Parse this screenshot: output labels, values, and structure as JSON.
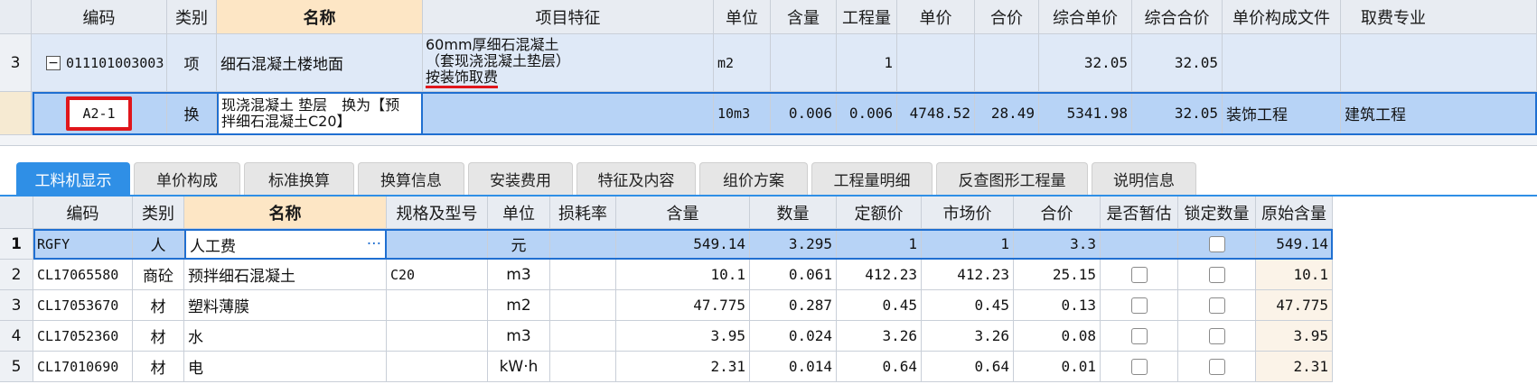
{
  "upper": {
    "headers": {
      "code": "编码",
      "category": "类别",
      "name": "名称",
      "feature": "项目特征",
      "unit": "单位",
      "content": "含量",
      "quantity": "工程量",
      "unit_price": "单价",
      "total": "合价",
      "comp_unit_price": "综合单价",
      "comp_total": "综合合价",
      "price_file": "单价构成文件",
      "fee_spec": "取费专业"
    },
    "row1": {
      "index": "3",
      "code": "011101003003",
      "category": "项",
      "name": "细石混凝土楼地面",
      "feature_line1": "60mm厚细石混凝土",
      "feature_line2": "（套现浇混凝土垫层）",
      "feature_line3": "按装饰取费",
      "unit": "m2",
      "content": "",
      "quantity": "1",
      "unit_price": "",
      "total": "",
      "comp_unit_price": "32.05",
      "comp_total": "32.05",
      "price_file": "",
      "fee_spec": ""
    },
    "row2": {
      "code": "A2-1",
      "category": "换",
      "name_line1": "现浇混凝土 垫层　换为【预",
      "name_line2": "拌细石混凝土C20】",
      "feature": "",
      "unit": "10m3",
      "content": "0.006",
      "quantity": "0.006",
      "unit_price": "4748.52",
      "total": "28.49",
      "comp_unit_price": "5341.98",
      "comp_total": "32.05",
      "price_file": "装饰工程",
      "fee_spec": "建筑工程"
    }
  },
  "tabs": [
    "工料机显示",
    "单价构成",
    "标准换算",
    "换算信息",
    "安装费用",
    "特征及内容",
    "组价方案",
    "工程量明细",
    "反查图形工程量",
    "说明信息"
  ],
  "lower": {
    "headers": {
      "code": "编码",
      "category": "类别",
      "name": "名称",
      "spec": "规格及型号",
      "unit": "单位",
      "loss": "损耗率",
      "content": "含量",
      "quantity": "数量",
      "quota_price": "定额价",
      "market_price": "市场价",
      "total": "合价",
      "provisional": "是否暂估",
      "lock_qty": "锁定数量",
      "orig_content": "原始含量"
    },
    "rows": [
      {
        "index": "1",
        "code": "RGFY",
        "category": "人",
        "name": "人工费",
        "spec": "",
        "unit": "元",
        "loss": "",
        "content": "549.14",
        "quantity": "3.295",
        "quota_price": "1",
        "market_price": "1",
        "total": "3.3",
        "orig_content": "549.14"
      },
      {
        "index": "2",
        "code": "CL17065580",
        "category": "商砼",
        "name": "预拌细石混凝土",
        "spec": "C20",
        "unit": "m3",
        "loss": "",
        "content": "10.1",
        "quantity": "0.061",
        "quota_price": "412.23",
        "market_price": "412.23",
        "total": "25.15",
        "orig_content": "10.1"
      },
      {
        "index": "3",
        "code": "CL17053670",
        "category": "材",
        "name": "塑料薄膜",
        "spec": "",
        "unit": "m2",
        "loss": "",
        "content": "47.775",
        "quantity": "0.287",
        "quota_price": "0.45",
        "market_price": "0.45",
        "total": "0.13",
        "orig_content": "47.775"
      },
      {
        "index": "4",
        "code": "CL17052360",
        "category": "材",
        "name": "水",
        "spec": "",
        "unit": "m3",
        "loss": "",
        "content": "3.95",
        "quantity": "0.024",
        "quota_price": "3.26",
        "market_price": "3.26",
        "total": "0.08",
        "orig_content": "3.95"
      },
      {
        "index": "5",
        "code": "CL17010690",
        "category": "材",
        "name": "电",
        "spec": "",
        "unit": "kW·h",
        "loss": "",
        "content": "2.31",
        "quantity": "0.014",
        "quota_price": "0.64",
        "market_price": "0.64",
        "total": "0.01",
        "orig_content": "2.31"
      }
    ],
    "ellipsis": "···"
  },
  "icons": {
    "collapse": "minus-box-icon"
  },
  "colors": {
    "accent": "#2f8fe6",
    "selected_row": "#b7d3f6",
    "highlight_red": "#e0161b",
    "name_header": "#fde6c5"
  }
}
